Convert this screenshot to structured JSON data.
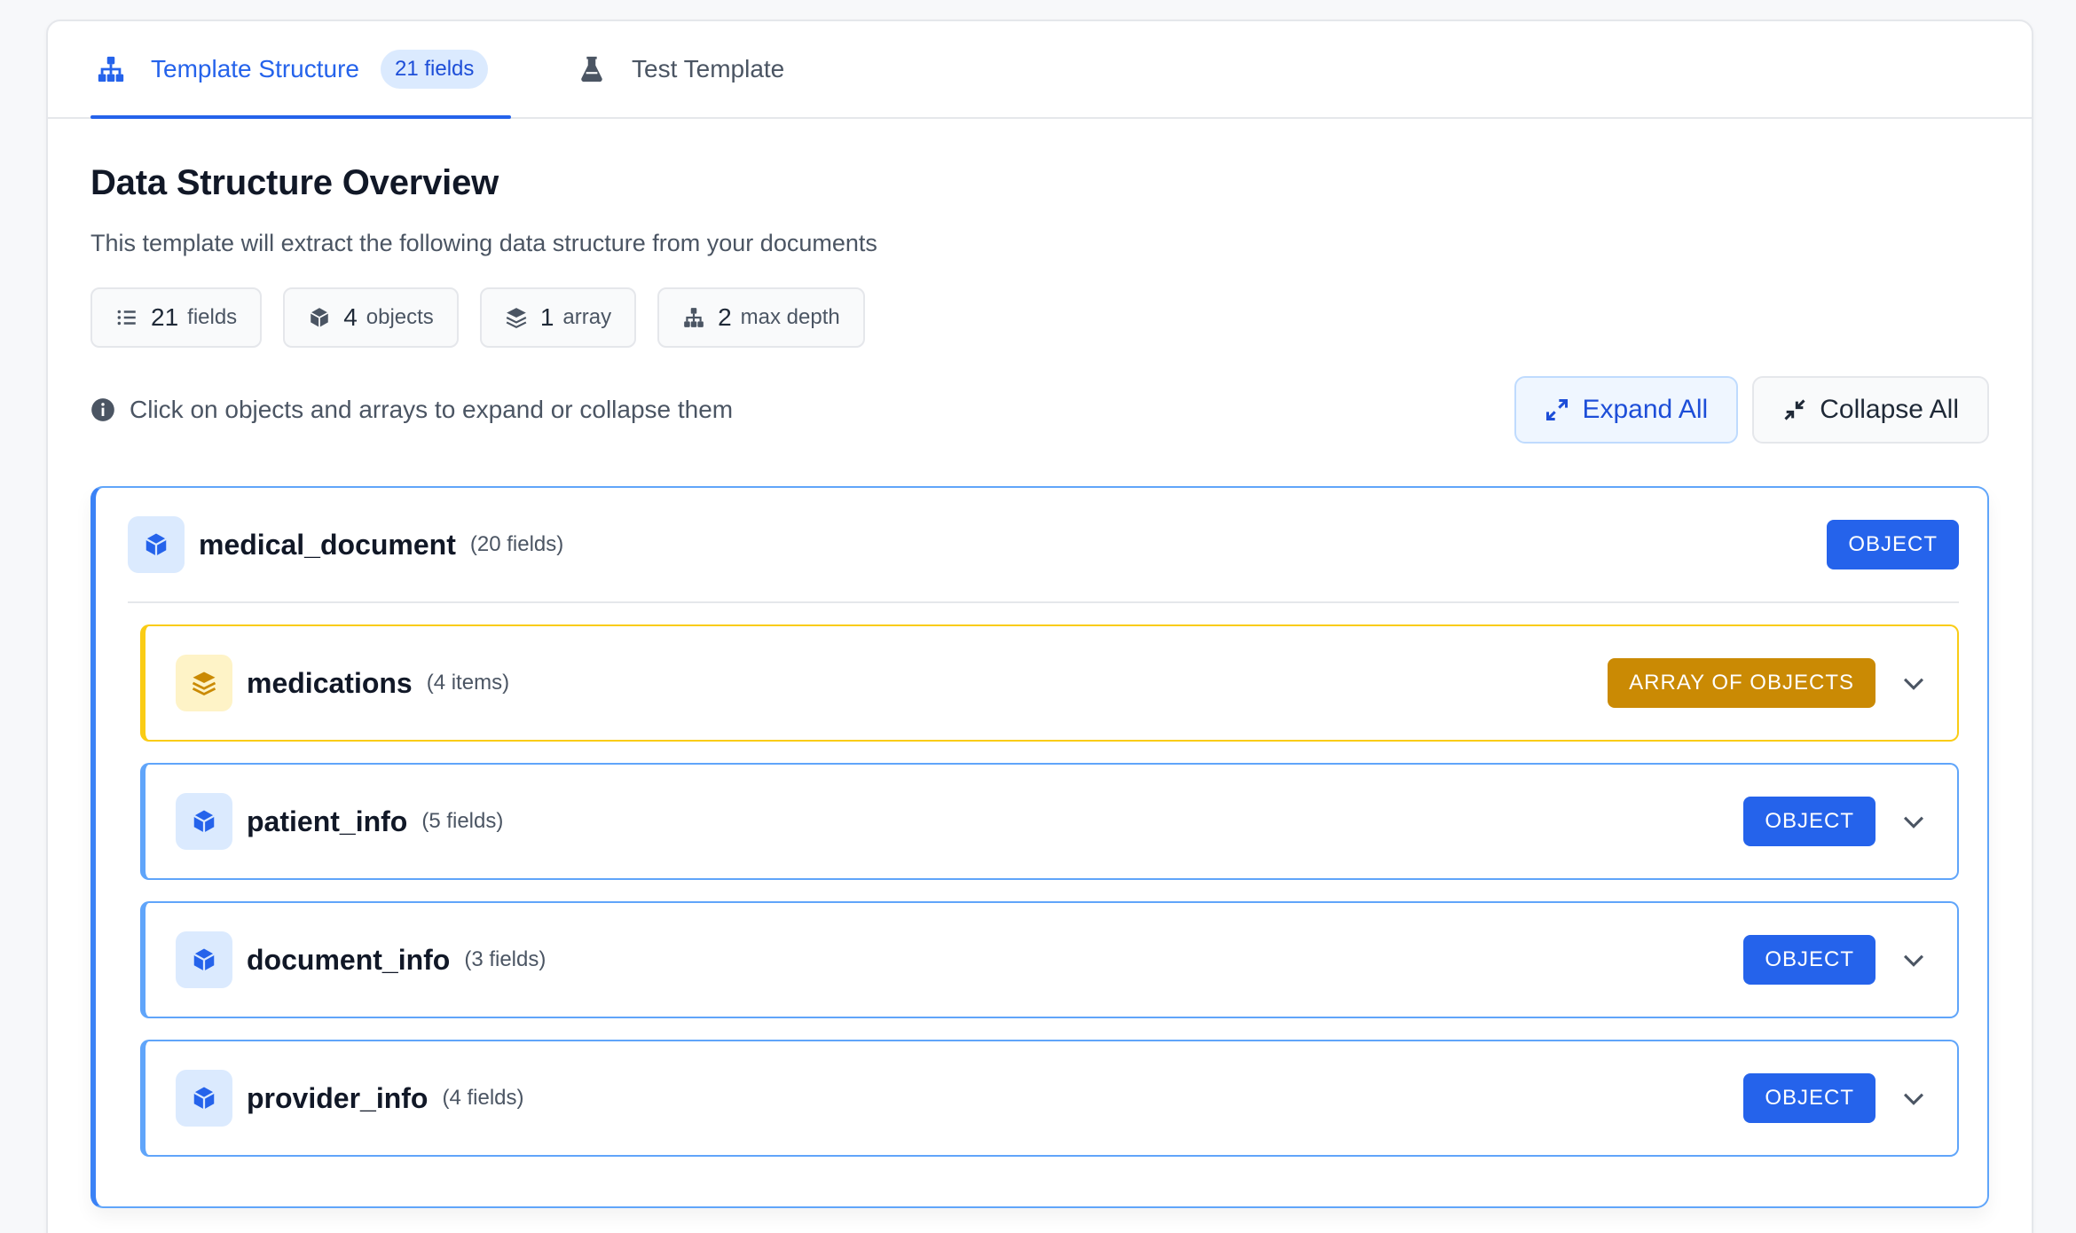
{
  "tabs": {
    "structure_label": "Template Structure",
    "structure_badge": "21 fields",
    "test_label": "Test Template"
  },
  "overview": {
    "title": "Data Structure Overview",
    "subtitle": "This template will extract the following data structure from your documents"
  },
  "stats": [
    {
      "num": "21",
      "label": "fields",
      "icon": "list-icon"
    },
    {
      "num": "4",
      "label": "objects",
      "icon": "cube-icon"
    },
    {
      "num": "1",
      "label": "array",
      "icon": "layers-icon"
    },
    {
      "num": "2",
      "label": "max depth",
      "icon": "sitemap-icon"
    }
  ],
  "hint": "Click on objects and arrays to expand or collapse them",
  "buttons": {
    "expand": "Expand All",
    "collapse": "Collapse All"
  },
  "tree": {
    "root": {
      "name": "medical_document",
      "count": "(20 fields)",
      "type": "OBJECT"
    },
    "children": [
      {
        "name": "medications",
        "count": "(4 items)",
        "type": "ARRAY OF OBJECTS",
        "color": "#ca8a04"
      },
      {
        "name": "patient_info",
        "count": "(5 fields)",
        "type": "OBJECT",
        "color": "#2563eb"
      },
      {
        "name": "document_info",
        "count": "(3 fields)",
        "type": "OBJECT",
        "color": "#2563eb"
      },
      {
        "name": "provider_info",
        "count": "(4 fields)",
        "type": "OBJECT",
        "color": "#2563eb"
      }
    ]
  },
  "colors": {
    "accent": "#2563eb",
    "array_accent": "#ca8a04"
  }
}
